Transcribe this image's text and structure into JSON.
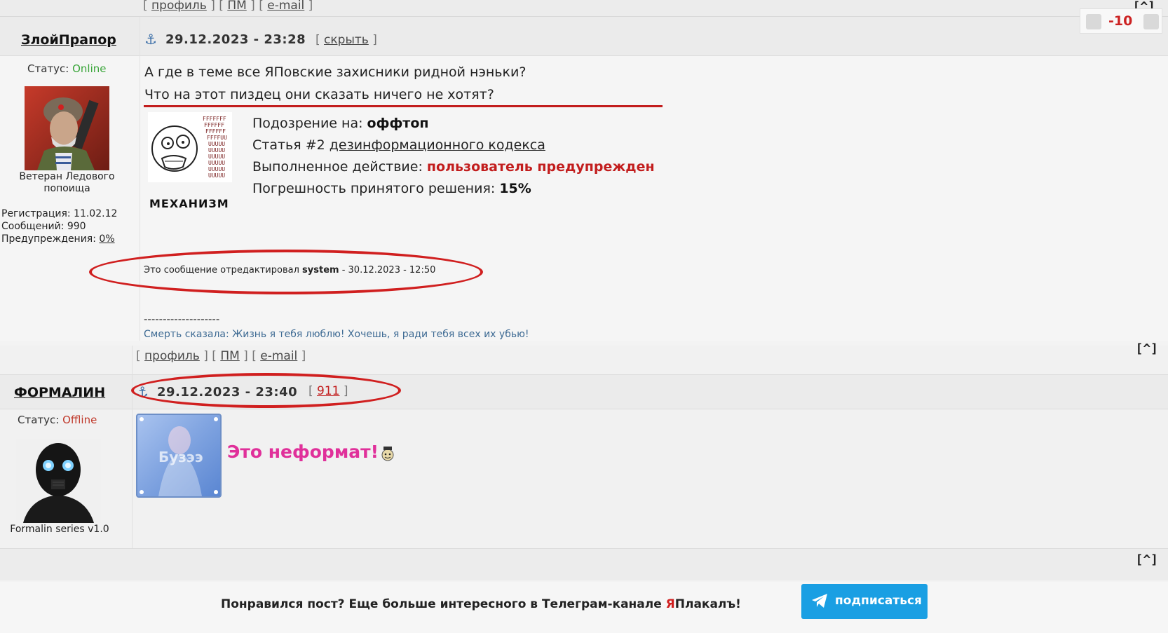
{
  "top_strip": {
    "profile": "профиль",
    "pm": "ПМ",
    "email": "e-mail",
    "up": "[^]"
  },
  "post1": {
    "author": "ЗлойПрапор",
    "status_label": "Статус:",
    "status_value": "Online",
    "avatar_caption_1": "Ветеран Ледового",
    "avatar_caption_2": "попоища",
    "reg": "Регистрация: 11.02.12",
    "messages": "Сообщений: 990",
    "warnings_label": "Предупреждения:",
    "warnings_value": "0%",
    "date": "29.12.2023 - 23:28",
    "hide": "скрыть",
    "rating": "-10",
    "text_line_1": "А где в теме все ЯПовские захисники ридной нэньки?",
    "text_line_2": "Что на этот пиздец они сказать ничего не хотят?",
    "mech_label": "МЕХАНИЗМ",
    "suspicion_label": "Подозрение на:",
    "suspicion_value": "оффтоп",
    "article_prefix": "Статья #2",
    "article_link": "дезинформационного кодекса",
    "action_label": "Выполненное действие:",
    "action_value": "пользователь предупрежден",
    "error_label": "Погрешность принятого решения:",
    "error_value": "15%",
    "edit_prefix": "Это сообщение отредактировал",
    "edit_user": "system",
    "edit_date": "- 30.12.2023 - 12:50",
    "sig_dash": "--------------------",
    "sig_text": "Смерть сказала: Жизнь я тебя люблю! Хочешь, я ради тебя всех их убью!"
  },
  "post2": {
    "profile": "профиль",
    "pm": "ПМ",
    "email": "e-mail",
    "up": "[^]",
    "author": "ФОРМАЛИН",
    "status_label": "Статус:",
    "status_value": "Offline",
    "avatar_caption": "Formalin series v1.0",
    "date": "29.12.2023 - 23:40",
    "reply_to": "911",
    "image_text": "Бузээ",
    "text": "Это неформат!",
    "foot_up": "[^]"
  },
  "promo": {
    "text_before": "Понравился пост? Еще больше интересного в Телеграм-канале ",
    "brand_ya": "Я",
    "brand_rest": "Плакалъ!",
    "button": "подписаться"
  },
  "colors": {
    "accent_red": "#c21d1d",
    "online": "#3aa53a",
    "offline": "#c0392b",
    "telegram_blue": "#1a9fe3",
    "pink": "#e0309a"
  }
}
